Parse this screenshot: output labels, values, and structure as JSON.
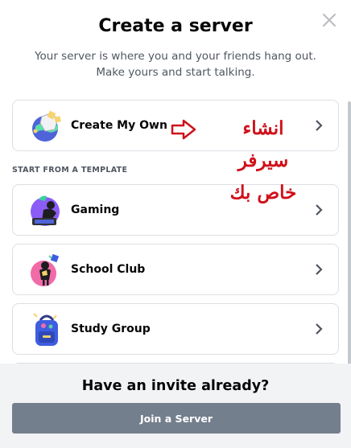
{
  "modal": {
    "title": "Create a server",
    "subtitle": "Your server is where you and your friends hang out. Make yours and start talking."
  },
  "options": {
    "create_own": {
      "label": "Create My Own",
      "icon": "globe-build-icon"
    },
    "section_label": "START FROM A TEMPLATE",
    "templates": [
      {
        "label": "Gaming",
        "icon": "gaming-icon"
      },
      {
        "label": "School Club",
        "icon": "school-club-icon"
      },
      {
        "label": "Study Group",
        "icon": "study-group-icon"
      }
    ]
  },
  "annotation": {
    "lines": [
      "انشاء",
      "سيرفر",
      "خاص بك"
    ],
    "color": "#d0101a"
  },
  "footer": {
    "title": "Have an invite already?",
    "join_label": "Join a Server"
  },
  "colors": {
    "button": "#747f8d",
    "footer_bg": "#f2f3f5"
  }
}
